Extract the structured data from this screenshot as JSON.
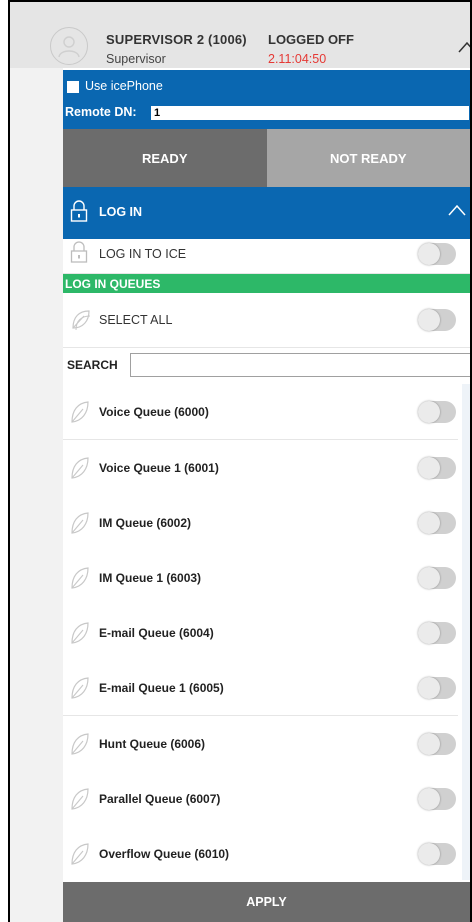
{
  "user": {
    "name": "SUPERVISOR 2 (1006)",
    "role": "Supervisor",
    "status": "LOGGED OFF",
    "timer": "2.11:04:50",
    "timer_color": "#e53935"
  },
  "icephone": {
    "label": "Use icePhone",
    "checked": false,
    "remote_dn_label": "Remote DN:",
    "remote_dn_value": "1"
  },
  "ready_state": {
    "ready_label": "READY",
    "not_ready_label": "NOT READY"
  },
  "login_section": {
    "title": "LOG IN",
    "login_to_ice_label": "LOG IN TO ICE",
    "login_to_ice_on": false
  },
  "queues": {
    "title": "LOG IN QUEUES",
    "select_all_label": "SELECT ALL",
    "search_label": "SEARCH",
    "search_value": "",
    "items": [
      {
        "label": "Voice Queue (6000)",
        "on": false
      },
      {
        "label": "Voice Queue 1 (6001)",
        "on": false
      },
      {
        "label": "IM Queue (6002)",
        "on": false
      },
      {
        "label": "IM Queue 1 (6003)",
        "on": false
      },
      {
        "label": "E-mail Queue (6004)",
        "on": false
      },
      {
        "label": "E-mail Queue 1 (6005)",
        "on": false
      },
      {
        "label": "Hunt Queue (6006)",
        "on": false
      },
      {
        "label": "Parallel Queue (6007)",
        "on": false
      },
      {
        "label": "Overflow Queue (6010)",
        "on": false
      }
    ]
  },
  "apply_label": "APPLY",
  "colors": {
    "primary_blue": "#0a67b1",
    "queue_green": "#2db868",
    "dark_gray": "#6c6c6c",
    "light_gray": "#a6a6a6"
  },
  "icons": [
    "user-avatar-icon",
    "chevron-up-icon",
    "lock-icon",
    "leaf-icon",
    "select-all-icon"
  ]
}
